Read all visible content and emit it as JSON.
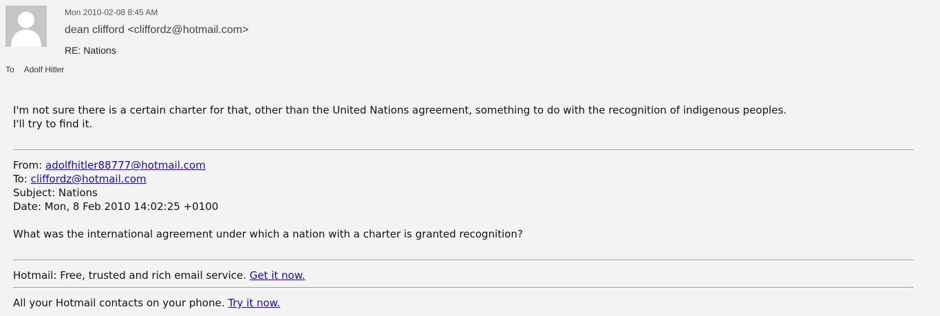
{
  "header": {
    "date": "Mon 2010-02-08 8:45 AM",
    "sender": "dean clifford <cliffordz@hotmail.com>",
    "subject": "RE: Nations",
    "to_label": "To",
    "to_value": "Adolf Hitler"
  },
  "message": {
    "reply_line1": "I'm not sure there is a certain charter for that, other than the United Nations agreement, something to do with the recognition of indigenous peoples.",
    "reply_line2": "I'll try to find it.",
    "quoted": {
      "from_label": "From:",
      "from_value": "adolfhitler88777@hotmail.com",
      "to_label": "To:",
      "to_value": "cliffordz@hotmail.com",
      "subject_line": "Subject: Nations",
      "date_line": "Date: Mon, 8 Feb 2010 14:02:25 +0100",
      "question": "What was the international agreement under which a nation with a charter is granted recognition?"
    },
    "footer1_text": "Hotmail: Free, trusted and rich email service.",
    "footer1_link": "Get it now.",
    "footer2_text": "All your Hotmail contacts on your phone.",
    "footer2_link": "Try it now."
  },
  "icons": {
    "avatar": "person-silhouette-icon"
  }
}
